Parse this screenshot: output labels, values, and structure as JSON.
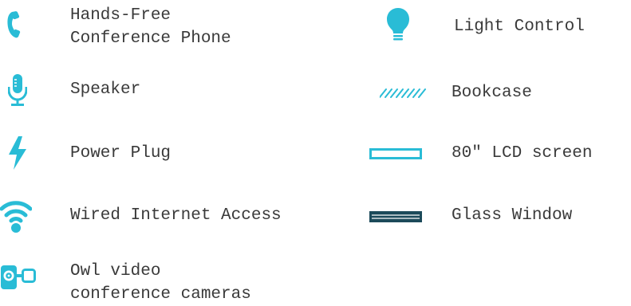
{
  "accent_color": "#29bcd6",
  "dark_color": "#1c4a5a",
  "legend": {
    "left_items": [
      {
        "icon": "phone-icon",
        "line1": "Hands-Free",
        "line2": "Conference Phone"
      },
      {
        "icon": "microphone-icon",
        "line1": "Speaker"
      },
      {
        "icon": "lightning-bolt-icon",
        "line1": "Power Plug"
      },
      {
        "icon": "wifi-icon",
        "line1": "Wired Internet Access"
      },
      {
        "icon": "video-camera-icon",
        "line1": "Owl video",
        "line2": "conference cameras"
      }
    ],
    "right_items": [
      {
        "icon": "light-bulb-icon",
        "line1": "Light Control"
      },
      {
        "icon": "bookcase-hatch-icon",
        "line1": "Bookcase"
      },
      {
        "icon": "lcd-screen-icon",
        "line1": "80\" LCD screen"
      },
      {
        "icon": "glass-window-icon",
        "line1": "Glass Window"
      }
    ]
  }
}
